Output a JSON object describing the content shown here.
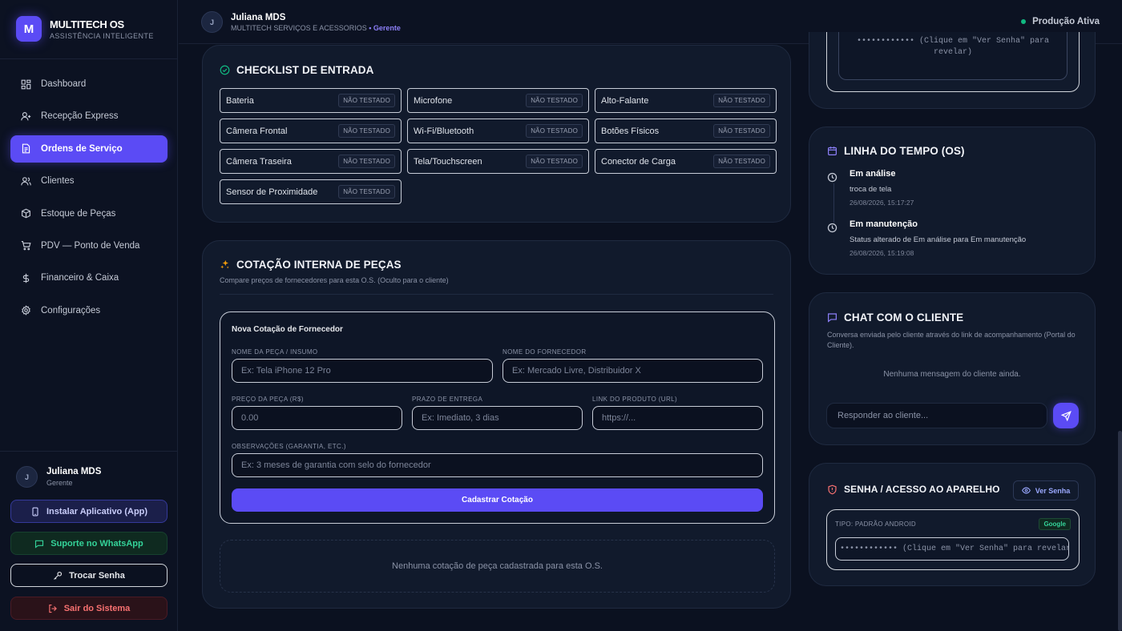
{
  "brand": {
    "logo_letter": "M",
    "title": "MULTITECH OS",
    "subtitle": "ASSISTÊNCIA INTELIGENTE"
  },
  "nav": [
    {
      "label": "Dashboard",
      "icon": "dashboard-icon",
      "active": false
    },
    {
      "label": "Recepção Express",
      "icon": "user-plus-icon",
      "active": false
    },
    {
      "label": "Ordens de Serviço",
      "icon": "document-icon",
      "active": true
    },
    {
      "label": "Clientes",
      "icon": "users-icon",
      "active": false
    },
    {
      "label": "Estoque de Peças",
      "icon": "box-icon",
      "active": false
    },
    {
      "label": "PDV — Ponto de Venda",
      "icon": "cart-icon",
      "active": false
    },
    {
      "label": "Financeiro & Caixa",
      "icon": "dollar-icon",
      "active": false
    },
    {
      "label": "Configurações",
      "icon": "gear-icon",
      "active": false
    }
  ],
  "sidebar_user": {
    "initial": "J",
    "name": "Juliana MDS",
    "role": "Gerente"
  },
  "sidebar_buttons": {
    "install": "Instalar Aplicativo (App)",
    "whatsapp": "Suporte no WhatsApp",
    "change_password": "Trocar Senha",
    "logout": "Sair do Sistema"
  },
  "header": {
    "initial": "J",
    "name": "Juliana MDS",
    "company": "MULTITECH SERVIÇOS E ACESSORIOS",
    "role": "• Gerente",
    "status": "Produção Ativa",
    "status_color": "#10b981"
  },
  "checklist": {
    "title": "CHECKLIST DE ENTRADA",
    "status_label": "NÃO TESTADO",
    "items": [
      "Bateria",
      "Microfone",
      "Alto-Falante",
      "Câmera Frontal",
      "Wi-Fi/Bluetooth",
      "Botões Físicos",
      "Câmera Traseira",
      "Tela/Touchscreen",
      "Conector de Carga",
      "Sensor de Proximidade"
    ]
  },
  "quote": {
    "title": "COTAÇÃO INTERNA DE PEÇAS",
    "subtitle": "Compare preços de fornecedores para esta O.S. (Oculto para o cliente)",
    "form_title": "Nova Cotação de Fornecedor",
    "part_label": "NOME DA PEÇA / INSUMO",
    "part_placeholder": "Ex: Tela iPhone 12 Pro",
    "supplier_label": "NOME DO FORNECEDOR",
    "supplier_placeholder": "Ex: Mercado Livre, Distribuidor X",
    "price_label": "PREÇO DA PEÇA (R$)",
    "price_placeholder": "0.00",
    "deadline_label": "PRAZO DE ENTREGA",
    "deadline_placeholder": "Ex: Imediato, 3 dias",
    "link_label": "LINK DO PRODUTO (URL)",
    "link_placeholder": "https://...",
    "notes_label": "OBSERVAÇÕES (GARANTIA, ETC.)",
    "notes_placeholder": "Ex: 3 meses de garantia com selo do fornecedor",
    "submit": "Cadastrar Cotação",
    "empty": "Nenhuma cotação de peça cadastrada para esta O.S."
  },
  "password_top": {
    "masked": "•••••••••••• (Clique em \"Ver Senha\" para revelar)"
  },
  "timeline": {
    "title": "LINHA DO TEMPO (OS)",
    "events": [
      {
        "title": "Em análise",
        "desc": "troca de tela",
        "date": "26/08/2026, 15:17:27"
      },
      {
        "title": "Em manutenção",
        "desc": "Status alterado de Em análise para Em manutenção",
        "date": "26/08/2026, 15:19:08"
      }
    ]
  },
  "chat": {
    "title": "CHAT COM O CLIENTE",
    "subtitle": "Conversa enviada pelo cliente através do link de acompanhamento (Portal do Cliente).",
    "empty": "Nenhuma mensagem do cliente ainda.",
    "placeholder": "Responder ao cliente..."
  },
  "device_password": {
    "title": "SENHA / ACESSO AO APARELHO",
    "view_button": "Ver Senha",
    "type": "TIPO: PADRÃO ANDROID",
    "badge": "Google",
    "masked": "•••••••••••• (Clique em \"Ver Senha\" para revelar)"
  },
  "colors": {
    "accent": "#5b4bf5",
    "background": "#0b1120",
    "card": "#111a2c",
    "success": "#34d399",
    "danger": "#f87171"
  }
}
